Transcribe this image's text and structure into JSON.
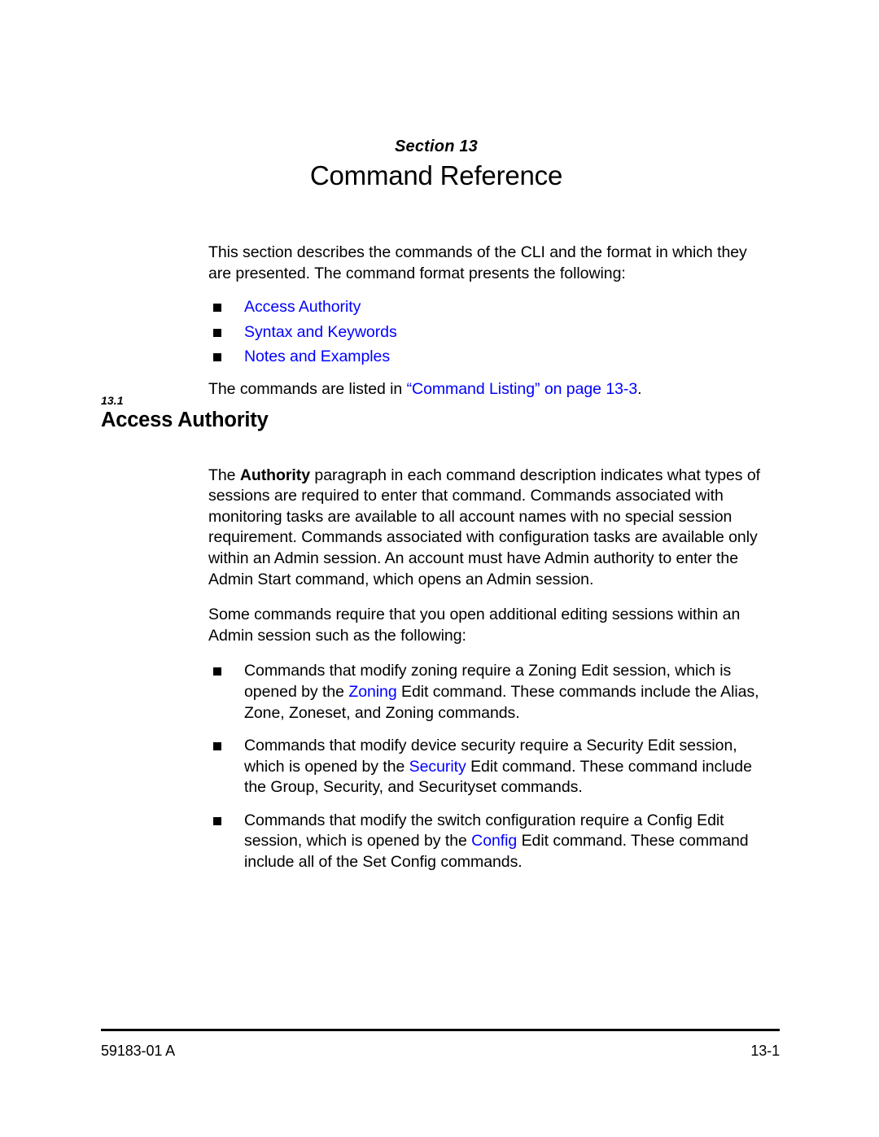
{
  "section": {
    "eyebrow": "Section 13",
    "title": "Command Reference"
  },
  "intro": {
    "paragraph": "This section describes the commands of the CLI and the format in which they are presented. The command format presents the following:",
    "items": [
      {
        "label": "Access Authority"
      },
      {
        "label": "Syntax and Keywords"
      },
      {
        "label": "Notes and Examples"
      }
    ],
    "listing_lead": "The commands are listed in ",
    "listing_link": "“Command Listing” on page 13-3",
    "listing_tail": "."
  },
  "heading": {
    "number": "13.1",
    "text": "Access Authority"
  },
  "authority": {
    "para1_lead": "The ",
    "para1_bold": "Authority",
    "para1_rest": " paragraph in each command description indicates what types of sessions are required to enter that command. Commands associated with monitoring tasks are available to all account names with no special session requirement. Commands associated with configuration tasks are available only within an Admin session. An account must have Admin authority to enter the Admin Start command, which opens an Admin session.",
    "para2": "Some commands require that you open additional editing sessions within an Admin session such as the following:",
    "items": [
      {
        "pre": "Commands that modify zoning require a Zoning Edit session, which is opened by the ",
        "link": "Zoning",
        "post": " Edit command. These commands include the Alias, Zone, Zoneset, and Zoning commands."
      },
      {
        "pre": "Commands that modify device security require a Security Edit session, which is opened by the ",
        "link": "Security",
        "post": " Edit command. These command include the Group, Security, and Securityset commands."
      },
      {
        "pre": "Commands that modify the switch configuration require a Config Edit session, which is opened by the ",
        "link": "Config",
        "post": " Edit command. These command include all of the Set Config commands."
      }
    ]
  },
  "footer": {
    "doc_id": "59183-01 A",
    "page_number": "13-1"
  },
  "colors": {
    "link": "#0000ff",
    "text": "#000000",
    "background": "#ffffff"
  }
}
